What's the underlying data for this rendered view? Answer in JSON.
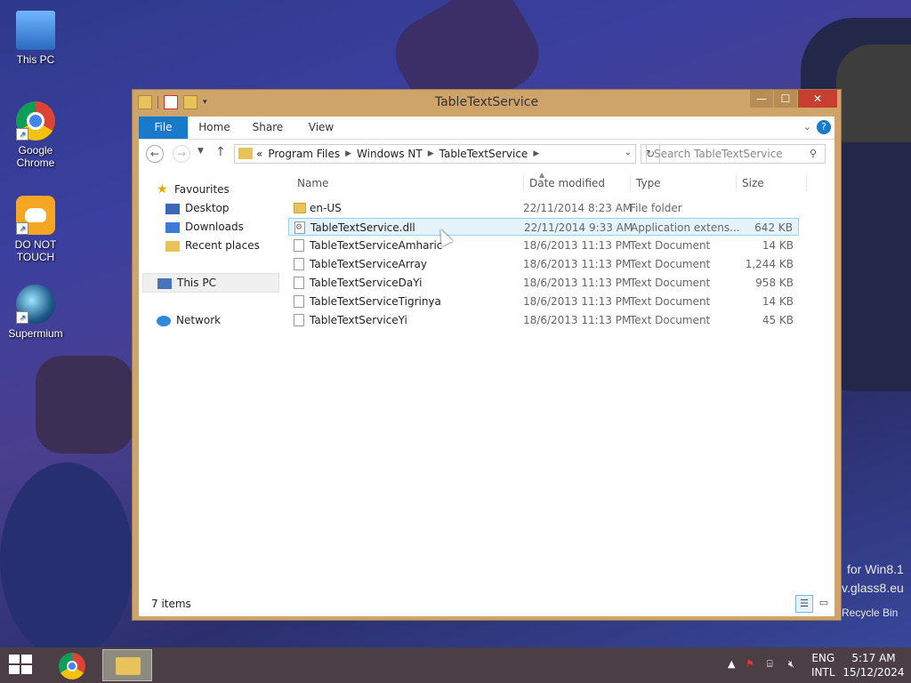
{
  "desktop": {
    "icons": [
      {
        "label": "This PC"
      },
      {
        "label": "Google Chrome"
      },
      {
        "label": "DO NOT TOUCH"
      },
      {
        "label": "Supermium"
      }
    ],
    "watermark_line1": "for Win8.1",
    "watermark_line2": "v.glass8.eu",
    "recycle_bin_label": "Recycle Bin"
  },
  "window": {
    "title": "TableTextService",
    "ribbon_tabs": [
      "File",
      "Home",
      "Share",
      "View"
    ],
    "address": {
      "overflow": "«",
      "crumbs": [
        "Program Files",
        "Windows NT",
        "TableTextService"
      ]
    },
    "search_placeholder": "Search TableTextService",
    "nav_pane": {
      "favourites": "Favourites",
      "desktop": "Desktop",
      "downloads": "Downloads",
      "recent": "Recent places",
      "this_pc": "This PC",
      "network": "Network"
    },
    "columns": {
      "name": "Name",
      "date": "Date modified",
      "type": "Type",
      "size": "Size"
    },
    "files": [
      {
        "name": "en-US",
        "date": "22/11/2014 8:23 AM",
        "type": "File folder",
        "size": "",
        "icon": "folder-icon"
      },
      {
        "name": "TableTextService.dll",
        "date": "22/11/2014 9:33 AM",
        "type": "Application extens...",
        "size": "642 KB",
        "icon": "dll-file-icon",
        "selected": true
      },
      {
        "name": "TableTextServiceAmharic",
        "date": "18/6/2013 11:13 PM",
        "type": "Text Document",
        "size": "14 KB",
        "icon": "text-file-icon"
      },
      {
        "name": "TableTextServiceArray",
        "date": "18/6/2013 11:13 PM",
        "type": "Text Document",
        "size": "1,244 KB",
        "icon": "text-file-icon"
      },
      {
        "name": "TableTextServiceDaYi",
        "date": "18/6/2013 11:13 PM",
        "type": "Text Document",
        "size": "958 KB",
        "icon": "text-file-icon"
      },
      {
        "name": "TableTextServiceTigrinya",
        "date": "18/6/2013 11:13 PM",
        "type": "Text Document",
        "size": "14 KB",
        "icon": "text-file-icon"
      },
      {
        "name": "TableTextServiceYi",
        "date": "18/6/2013 11:13 PM",
        "type": "Text Document",
        "size": "45 KB",
        "icon": "text-file-icon"
      }
    ],
    "status": "7 items"
  },
  "taskbar": {
    "lang_line1": "ENG",
    "lang_line2": "INTL",
    "time": "5:17 AM",
    "date": "15/12/2024"
  },
  "colors": {
    "accent": "#1979ca",
    "window_frame": "#cfa46a",
    "close_button": "#c7402f",
    "selection": "#e5f3fb"
  }
}
